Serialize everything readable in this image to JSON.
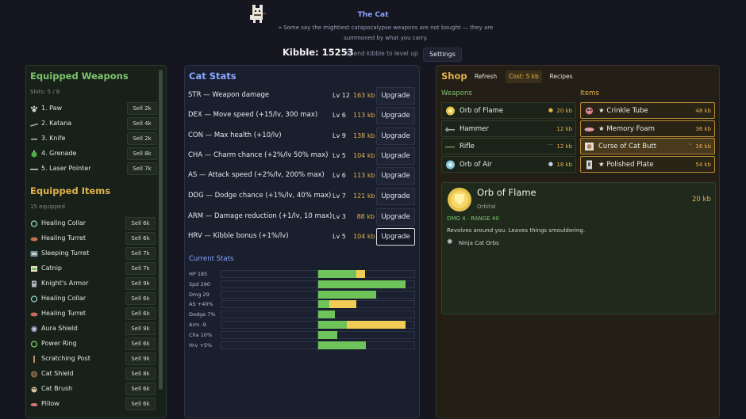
{
  "header": {
    "cat_name": "The Cat",
    "tagline": "« Some say the mightiest catapocalypse weapons are not bought — they are summoned by what you carry.",
    "kibble": "Kibble: 15253",
    "kibble_hint": "Spend kibble to level up",
    "settings_label": "Settings"
  },
  "left": {
    "weapons_title": "Equipped Weapons",
    "slots": "Slots: 5 / 6",
    "weapons": [
      {
        "name": "1. Paw",
        "sell": "Sell 2k",
        "icon": "paw-icon"
      },
      {
        "name": "2. Katana",
        "sell": "Sell 4k",
        "icon": "katana-icon"
      },
      {
        "name": "3. Knife",
        "sell": "Sell 2k",
        "icon": "knife-icon"
      },
      {
        "name": "4. Grenade",
        "sell": "Sell 8k",
        "icon": "grenade-icon"
      },
      {
        "name": "5. Laser Pointer",
        "sell": "Sell 7k",
        "icon": "laser-pointer-icon"
      }
    ],
    "items_title": "Equipped Items",
    "items_count": "15 equipped",
    "items": [
      {
        "name": "Healing Collar",
        "sell": "Sell 6k",
        "icon": "collar-icon"
      },
      {
        "name": "Healing Turret",
        "sell": "Sell 6k",
        "icon": "turret-icon"
      },
      {
        "name": "Sleeping Turret",
        "sell": "Sell 7k",
        "icon": "sleeping-turret-icon"
      },
      {
        "name": "Catnip",
        "sell": "Sell 7k",
        "icon": "catnip-icon"
      },
      {
        "name": "Knight's Armor",
        "sell": "Sell 9k",
        "icon": "armor-icon"
      },
      {
        "name": "Healing Collar",
        "sell": "Sell 6k",
        "icon": "collar-icon"
      },
      {
        "name": "Healing Turret",
        "sell": "Sell 6k",
        "icon": "turret-icon"
      },
      {
        "name": "Aura Shield",
        "sell": "Sell 9k",
        "icon": "aura-shield-icon"
      },
      {
        "name": "Power Ring",
        "sell": "Sell 6k",
        "icon": "ring-icon"
      },
      {
        "name": "Scratching Post",
        "sell": "Sell 9k",
        "icon": "scratching-post-icon"
      },
      {
        "name": "Cat Shield",
        "sell": "Sell 8k",
        "icon": "shield-icon"
      },
      {
        "name": "Cat Brush",
        "sell": "Sell 6k",
        "icon": "brush-icon"
      },
      {
        "name": "Pillow",
        "sell": "Sell 6k",
        "icon": "pillow-icon"
      }
    ]
  },
  "stats": {
    "title": "Cat Stats",
    "upgrade_label": "Upgrade",
    "rows": [
      {
        "label": "STR — Weapon damage",
        "lv": "Lv 12",
        "cost": "163 kb"
      },
      {
        "label": "DEX — Move speed (+15/lv, 300 max)",
        "lv": "Lv 6",
        "cost": "113 kb"
      },
      {
        "label": "CON — Max health (+10/lv)",
        "lv": "Lv 9",
        "cost": "138 kb"
      },
      {
        "label": "CHA — Charm chance (+2%/lv 50% max)",
        "lv": "Lv 5",
        "cost": "104 kb"
      },
      {
        "label": "AS — Attack speed (+2%/lv, 200% max)",
        "lv": "Lv 6",
        "cost": "113 kb"
      },
      {
        "label": "DDG — Dodge chance (+1%/lv, 40% max)",
        "lv": "Lv 7",
        "cost": "121 kb"
      },
      {
        "label": "ARM — Damage reduction (+1/lv, 10 max)",
        "lv": "Lv 3",
        "cost": "88 kb"
      },
      {
        "label": "HRV — Kibble bonus (+1%/lv)",
        "lv": "Lv 5",
        "cost": "104 kb"
      }
    ],
    "current_title": "Current Stats",
    "current": [
      {
        "label": "HP 185",
        "green": 0.2,
        "yellow": 0.045
      },
      {
        "label": "Spd 290",
        "green": 0.455,
        "yellow": 0
      },
      {
        "label": "Dmg 29",
        "green": 0.3,
        "yellow": 0
      },
      {
        "label": "AS +40%",
        "green": 0.06,
        "yellow": 0.14
      },
      {
        "label": "Dodge 7%",
        "green": 0.09,
        "yellow": 0
      },
      {
        "label": "Arm -9",
        "green": 0.15,
        "yellow": 0.3
      },
      {
        "label": "Cha 10%",
        "green": 0.1,
        "yellow": 0
      },
      {
        "label": "Hrv +5%",
        "green": 0.25,
        "yellow": 0
      }
    ]
  },
  "shop": {
    "title": "Shop",
    "refresh_label": "Refresh",
    "cost_label": "Cost: 5 kb",
    "recipes_label": "Recipes",
    "weapons_title": "Weapons",
    "items_title": "Items",
    "weapons": [
      {
        "name": "Orb of Flame",
        "price": "20 kb",
        "icon": "orb-icon"
      },
      {
        "name": "Hammer",
        "price": "12 kb",
        "icon": "hammer-icon"
      },
      {
        "name": "Rifle",
        "price": "12 kb",
        "icon": "rifle-icon"
      },
      {
        "name": "Orb of Air",
        "price": "18 kb",
        "icon": "orb-air-icon"
      }
    ],
    "items": [
      {
        "name": "★ Crinkle Tube",
        "price": "48 kb",
        "icon": "crinkle-tube-icon"
      },
      {
        "name": "★ Memory Foam",
        "price": "36 kb",
        "icon": "memory-foam-icon"
      },
      {
        "name": "Curse of Cat Butt",
        "price": "16 kb",
        "icon": "cat-butt-icon"
      },
      {
        "name": "★ Polished Plate",
        "price": "54 kb",
        "icon": "plate-icon"
      }
    ],
    "detail": {
      "name": "Orb of Flame",
      "type": "Orbital",
      "stats": "DMG 4 · RANGE 40",
      "desc": "Revolves around you. Leaves things smouldering.",
      "synergy": "Ninja Cat Orbs",
      "price": "20 kb"
    }
  }
}
